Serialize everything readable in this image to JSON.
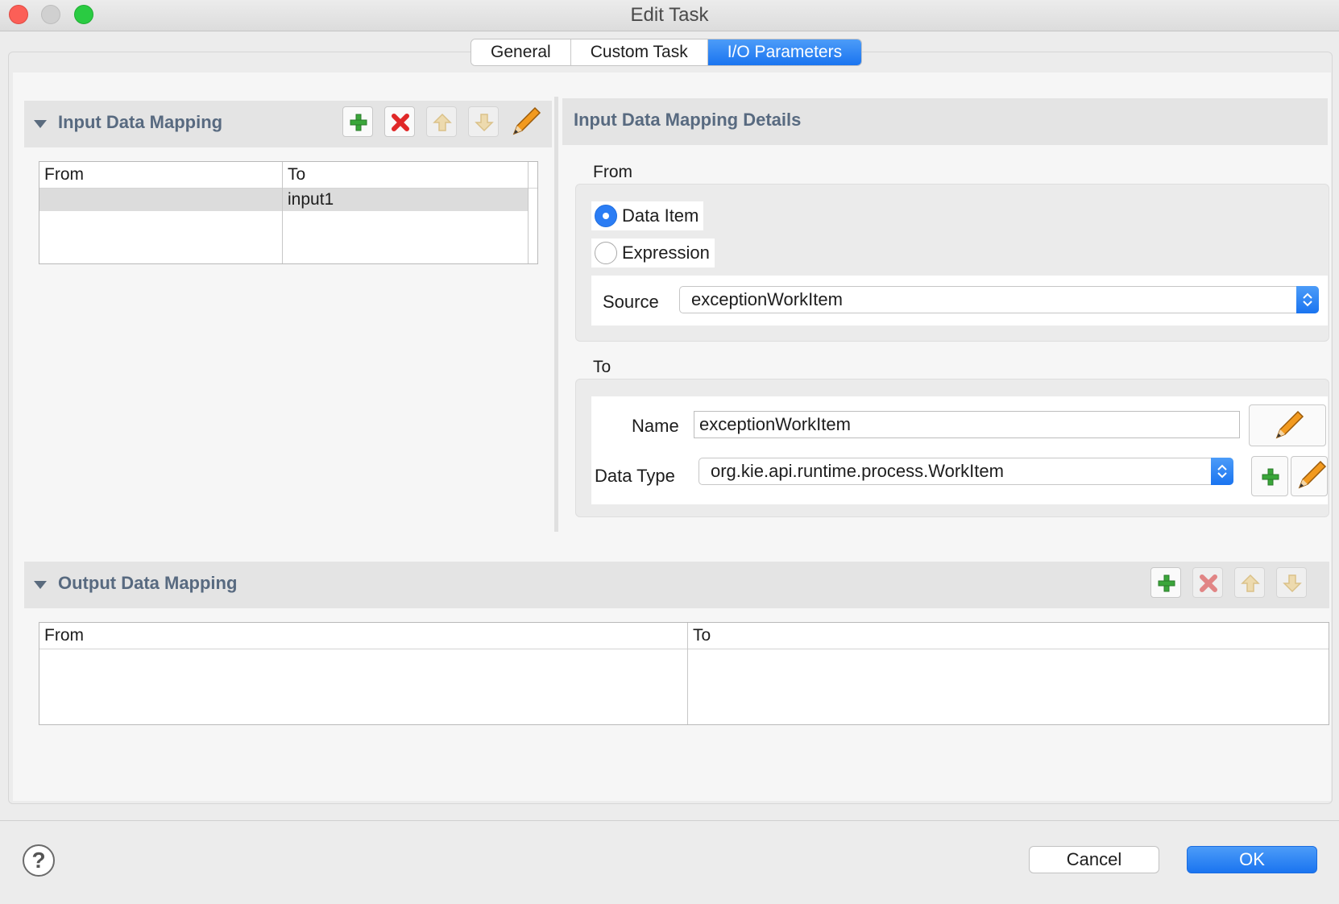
{
  "window": {
    "title": "Edit Task"
  },
  "tabs": [
    {
      "label": "General",
      "active": false
    },
    {
      "label": "Custom Task",
      "active": false
    },
    {
      "label": "I/O Parameters",
      "active": true
    }
  ],
  "input_mapping": {
    "title": "Input Data Mapping",
    "columns": [
      "From",
      "To"
    ],
    "rows": [
      {
        "from": "",
        "to": "input1",
        "selected": true
      }
    ]
  },
  "details": {
    "title": "Input Data Mapping Details",
    "from_label": "From",
    "radio_data_item": "Data Item",
    "radio_expression": "Expression",
    "selected_radio": "Data Item",
    "source_label": "Source",
    "source_value": "exceptionWorkItem",
    "to_label": "To",
    "name_label": "Name",
    "name_value": "exceptionWorkItem",
    "data_type_label": "Data Type",
    "data_type_value": "org.kie.api.runtime.process.WorkItem"
  },
  "output_mapping": {
    "title": "Output Data Mapping",
    "columns": [
      "From",
      "To"
    ],
    "rows": []
  },
  "footer": {
    "help": "?",
    "cancel": "Cancel",
    "ok": "OK"
  },
  "colors": {
    "accent": "#1a74f0",
    "section_title": "#586a80",
    "add_icon": "#3aa63a",
    "delete_icon": "#e02828",
    "arrow_icon": "#f2c24a"
  },
  "icons": [
    "help-icon",
    "add-icon",
    "delete-icon",
    "move-up-icon",
    "move-down-icon",
    "edit-pencil-icon",
    "chevron-updown-icon",
    "collapse-triangle-icon"
  ]
}
